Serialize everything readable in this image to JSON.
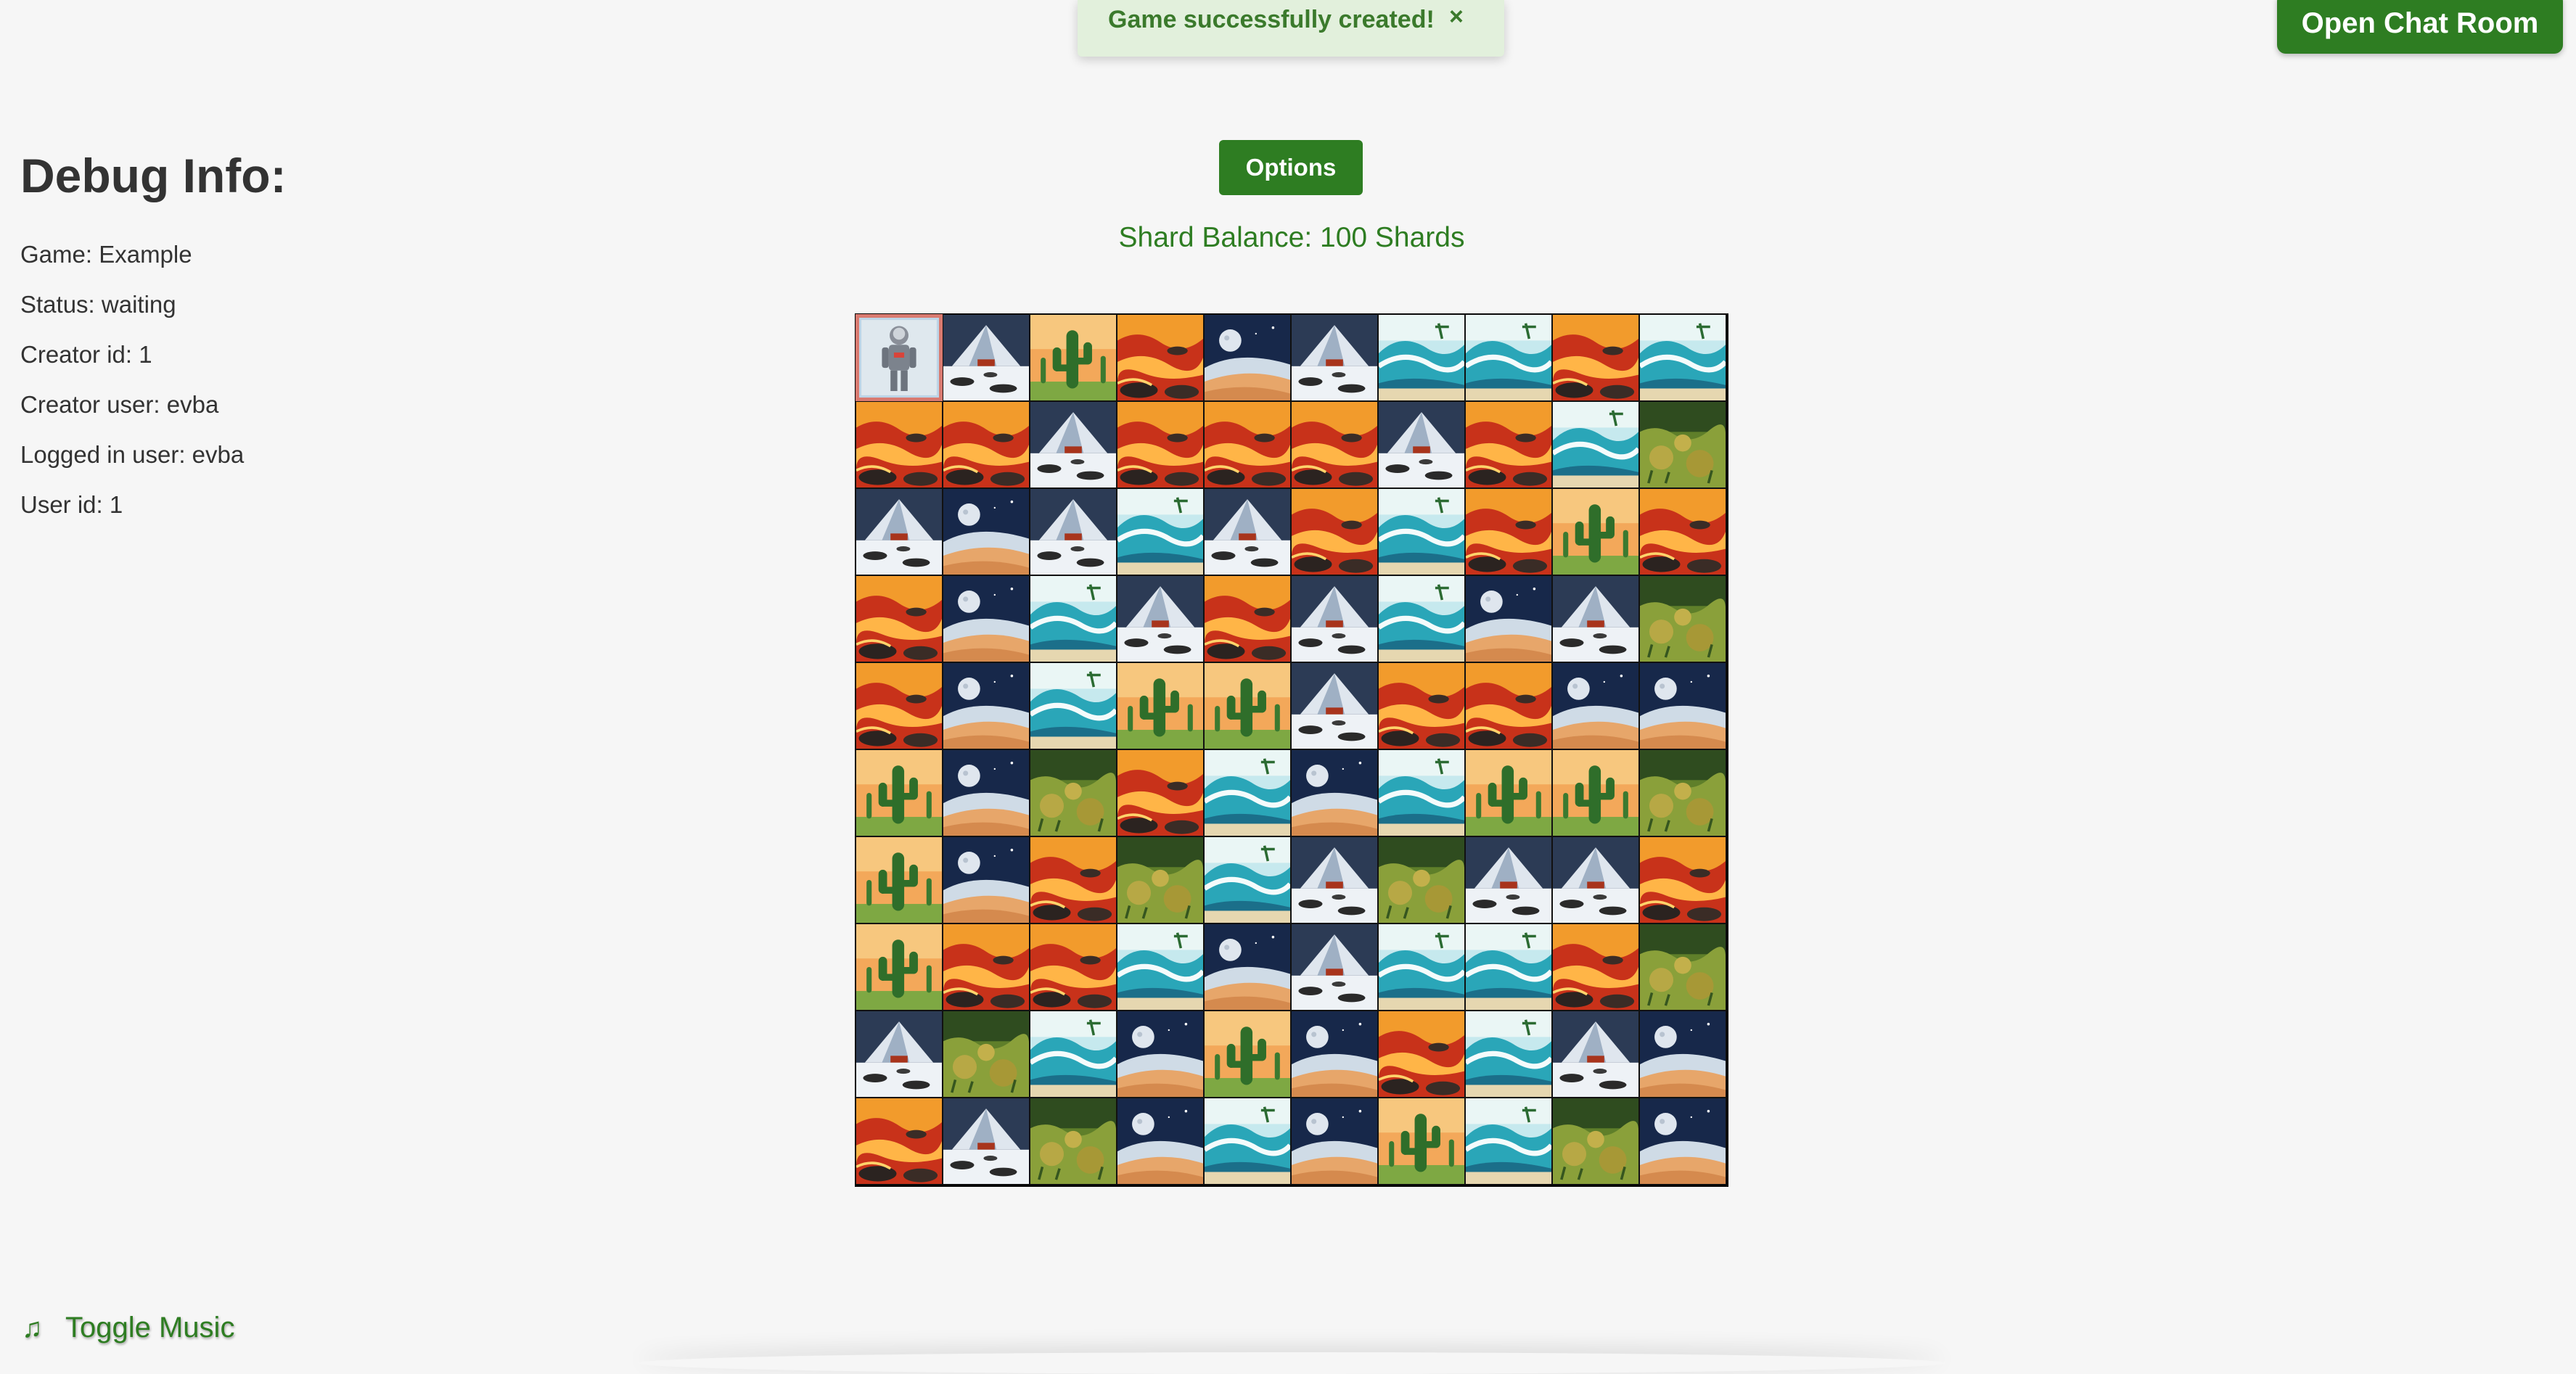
{
  "toast": {
    "message": "Game successfully created!",
    "close_label": "×"
  },
  "header": {
    "chat_label": "Open Chat Room"
  },
  "debug": {
    "title": "Debug Info:",
    "lines": [
      "Game: Example",
      "Status: waiting",
      "Creator id: 1",
      "Creator user: evba",
      "Logged in user: evba",
      "User id: 1"
    ]
  },
  "controls": {
    "options_label": "Options",
    "shard_balance": "Shard Balance: 100 Shards"
  },
  "footer": {
    "music_icon": "music-note-icon",
    "music_label": "Toggle Music",
    "music_glyph": "♫"
  },
  "board": {
    "player_position": [
      0,
      0
    ],
    "rows": [
      [
        "player",
        "snow",
        "cactus",
        "lava",
        "moon",
        "snow",
        "wave",
        "wave",
        "lava",
        "wave"
      ],
      [
        "lava",
        "lava",
        "snow",
        "lava",
        "lava",
        "lava",
        "snow",
        "lava",
        "wave",
        "grass"
      ],
      [
        "snow",
        "moon",
        "snow",
        "wave",
        "snow",
        "lava",
        "wave",
        "lava",
        "cactus",
        "lava"
      ],
      [
        "lava",
        "moon",
        "wave",
        "snow",
        "lava",
        "snow",
        "wave",
        "moon",
        "snow",
        "grass"
      ],
      [
        "lava",
        "moon",
        "wave",
        "cactus",
        "cactus",
        "snow",
        "lava",
        "lava",
        "moon",
        "moon"
      ],
      [
        "cactus",
        "moon",
        "grass",
        "lava",
        "wave",
        "moon",
        "wave",
        "cactus",
        "cactus",
        "grass"
      ],
      [
        "cactus",
        "moon",
        "lava",
        "grass",
        "wave",
        "snow",
        "grass",
        "snow",
        "snow",
        "lava"
      ],
      [
        "cactus",
        "lava",
        "lava",
        "wave",
        "moon",
        "snow",
        "wave",
        "wave",
        "lava",
        "grass"
      ],
      [
        "snow",
        "grass",
        "wave",
        "moon",
        "cactus",
        "moon",
        "lava",
        "wave",
        "snow",
        "moon"
      ],
      [
        "lava",
        "snow",
        "grass",
        "moon",
        "wave",
        "moon",
        "cactus",
        "wave",
        "grass",
        "moon"
      ]
    ]
  }
}
